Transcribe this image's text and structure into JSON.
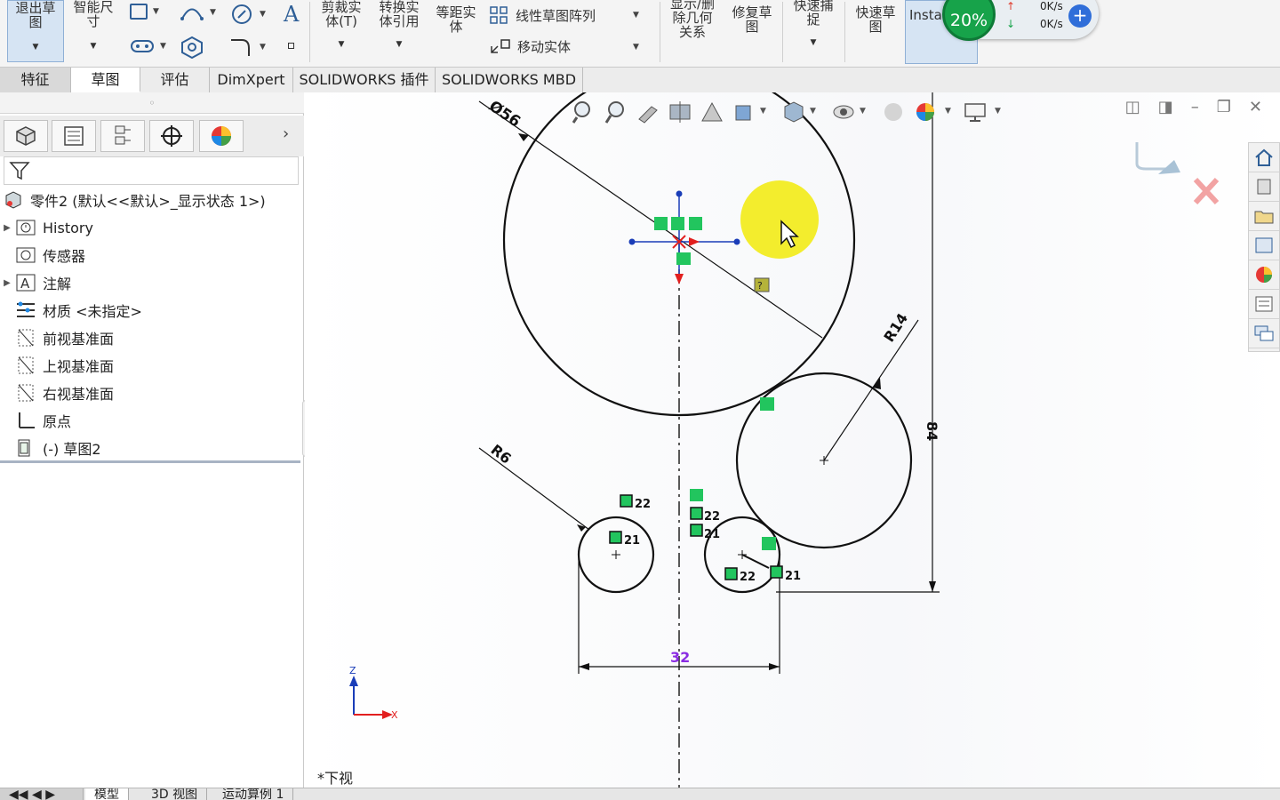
{
  "ribbon": {
    "exit_sketch": "退出草\n图",
    "smart_dim": "智能尺\n寸",
    "trim": "剪裁实\n体(T)",
    "convert": "转换实\n体引用",
    "offset": "等距实\n体",
    "linear_pattern": "线性草图阵列",
    "move_entities": "移动实体",
    "show_relations": "显示/删\n除几何\n关系",
    "repair": "修复草\n图",
    "quick_snap": "快速捕\n捉",
    "rapid_sketch": "快速草\n图",
    "instant": "Insta",
    "progress": "20%",
    "upload_speed": "0K/s",
    "download_speed": "0K/s"
  },
  "tabs": [
    "特征",
    "草图",
    "评估",
    "DimXpert",
    "SOLIDWORKS 插件",
    "SOLIDWORKS MBD"
  ],
  "tree": {
    "part": "零件2 (默认<<默认>_显示状态 1>)",
    "items": [
      "History",
      "传感器",
      "注解",
      "材质 <未指定>",
      "前视基准面",
      "上视基准面",
      "右视基准面",
      "原点",
      "(-) 草图2"
    ]
  },
  "sketch": {
    "dims": {
      "big_diameter": "Ø56",
      "r14": "R14",
      "r6": "R6",
      "vertical": "84",
      "horizontal": "32"
    },
    "relation_labels": [
      "22",
      "21",
      "22",
      "21",
      "22",
      "21"
    ],
    "axis_z": "Z",
    "axis_x": "X"
  },
  "view_label": "*下视",
  "bottom_tabs": [
    "模型",
    "3D 视图",
    "运动算例 1"
  ],
  "colors": {
    "accent": "#2f6ed9",
    "progress_green": "#17a34a",
    "dim_purple": "#8a2be2",
    "relation_green": "#22c55e"
  }
}
